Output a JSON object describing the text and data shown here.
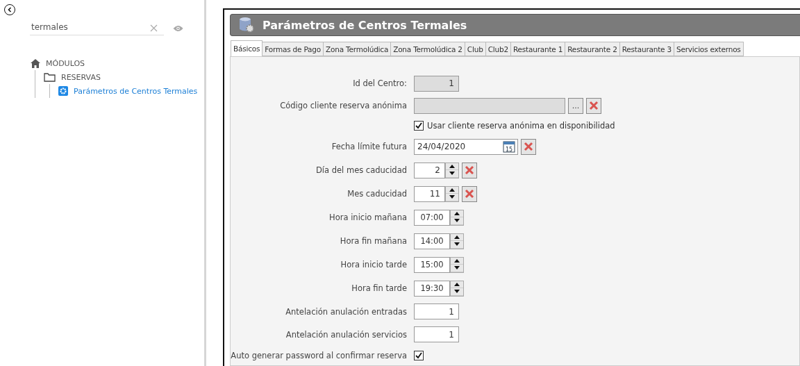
{
  "sidebar": {
    "search": {
      "value": "termales"
    },
    "tree": [
      {
        "label": "MÓDULOS",
        "kind": "home",
        "children": [
          {
            "label": "RESERVAS",
            "kind": "folder",
            "children": [
              {
                "label": "Parámetros de Centros Termales",
                "kind": "gear",
                "selected": true
              }
            ]
          }
        ]
      }
    ]
  },
  "window": {
    "title": "Parámetros de Centros Termales"
  },
  "tabs": [
    {
      "label": "Básicos",
      "selected": true
    },
    {
      "label": "Formas de Pago",
      "selected": false
    },
    {
      "label": "Zona Termolúdica",
      "selected": false
    },
    {
      "label": "Zona Termolúdica 2",
      "selected": false
    },
    {
      "label": "Club",
      "selected": false
    },
    {
      "label": "Club2",
      "selected": false
    },
    {
      "label": "Restaurante 1",
      "selected": false
    },
    {
      "label": "Restaurante 2",
      "selected": false
    },
    {
      "label": "Restaurante 3",
      "selected": false
    },
    {
      "label": "Servicios externos",
      "selected": false
    }
  ],
  "fields": [
    {
      "kind": "readonly",
      "label": "Id del Centro:",
      "value": "1"
    },
    {
      "kind": "lookup",
      "label": "Código cliente reserva anónima",
      "browse": "..."
    },
    {
      "kind": "check",
      "text": "Usar cliente reserva anónima en disponibilidad",
      "checked": true
    },
    {
      "kind": "date",
      "label": "Fecha límite futura",
      "value": "24/04/2020",
      "calendar_day": "15"
    },
    {
      "kind": "spin",
      "label": "Día del mes caducidad",
      "value": "2"
    },
    {
      "kind": "spin",
      "label": "Mes caducidad",
      "value": "11"
    },
    {
      "kind": "time",
      "label": "Hora inicio mañana",
      "value": "07:00"
    },
    {
      "kind": "time",
      "label": "Hora fin mañana",
      "value": "14:00"
    },
    {
      "kind": "time",
      "label": "Hora inicio tarde",
      "value": "15:00"
    },
    {
      "kind": "time",
      "label": "Hora fin tarde",
      "value": "19:30"
    },
    {
      "kind": "number",
      "label": "Antelación anulación entradas",
      "value": "1"
    },
    {
      "kind": "number",
      "label": "Antelación anulación servicios",
      "value": "1"
    },
    {
      "kind": "labelcheck",
      "label": "Auto generar password al confirmar reserva",
      "checked": true
    }
  ]
}
